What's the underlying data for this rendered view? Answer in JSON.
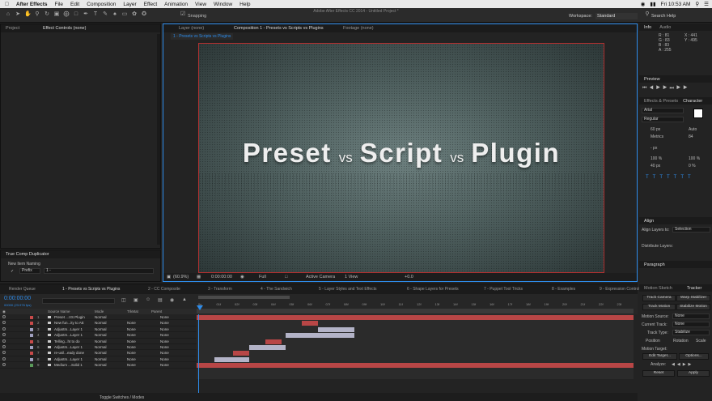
{
  "menubar": {
    "app": "After Effects",
    "items": [
      "File",
      "Edit",
      "Composition",
      "Layer",
      "Effect",
      "Animation",
      "View",
      "Window",
      "Help"
    ],
    "clock": "Fri 10:53 AM"
  },
  "toolbar": {
    "window_title": "Adobe After Effects CC 2014 - Untitled Project *",
    "snapping": "Snapping",
    "workspace_label": "Workspace:",
    "workspace_value": "Standard",
    "search_help": "Search Help"
  },
  "left_panel": {
    "tabs": [
      "Project",
      "Effect Controls (none)"
    ],
    "script_title": "True Comp Duplicator",
    "new_item_naming": "New Item Naming",
    "prefix_label": "Prefix",
    "prefix_value": "1 -"
  },
  "viewer": {
    "tabs": [
      "Layer (none)",
      "Composition 1 - Presets vs Scripts vs Plugins",
      "Footage (none)"
    ],
    "comp_chip": "1 - Presets vs Scripts vs Plugins",
    "comp_text": {
      "w1": "Preset",
      "vs1": "vs",
      "w2": "Script",
      "vs2": "vs",
      "w3": "Plugin"
    },
    "bottom": {
      "zoom": "(60.9%)",
      "timecode": "0:00:00:00",
      "resolution": "Full",
      "camera": "Active Camera",
      "views": "1 View",
      "exposure": "+0.0"
    }
  },
  "timeline": {
    "tabs": [
      "Render Queue",
      "1 - Presets vs Scripts vs Plugins",
      "2 - CC Composite",
      "3 - Transform",
      "4 - The Sandwich",
      "5 - Layer Styles and Text Effects",
      "6 - Shape Layers for Presets",
      "7 - Puppet Tool Tricks",
      "8 - Examples",
      "9 - Expression Controls"
    ],
    "timecode": "0:00:00:00",
    "frames": "00000 (23.976 fps)",
    "columns": {
      "source": "Source Name",
      "mode": "Mode",
      "trkmat": "TrkMat",
      "parent": "Parent"
    },
    "ruler_ticks": [
      "0s",
      "01f",
      "02f",
      "03f",
      "04f",
      "05f",
      "06f",
      "07f",
      "08f",
      "09f",
      "10f",
      "11f",
      "12f",
      "13f",
      "14f",
      "15f",
      "16f",
      "17f",
      "18f",
      "19f",
      "20f",
      "21f",
      "22f",
      "23f"
    ],
    "layers": [
      {
        "num": "1",
        "name": "Preset ...VS Plugin",
        "mode": "Normal",
        "trkmat": "",
        "parent": "None",
        "color": "#c84a4a"
      },
      {
        "num": "2",
        "name": "New fun...ity to AE",
        "mode": "Normal",
        "trkmat": "None",
        "parent": "None",
        "color": "#c84a4a"
      },
      {
        "num": "3",
        "name": "Adjustm...Layer 1",
        "mode": "Normal",
        "trkmat": "None",
        "parent": "None",
        "color": "#a0a0c0"
      },
      {
        "num": "4",
        "name": "Adjustm...Layer 1",
        "mode": "Normal",
        "trkmat": "None",
        "parent": "None",
        "color": "#a0a0c0"
      },
      {
        "num": "5",
        "name": "Telling...ht to do",
        "mode": "Normal",
        "trkmat": "None",
        "parent": "None",
        "color": "#c84a4a"
      },
      {
        "num": "6",
        "name": "Adjustm...Layer 1",
        "mode": "Normal",
        "trkmat": "None",
        "parent": "None",
        "color": "#a0a0c0"
      },
      {
        "num": "7",
        "name": "re-usil...eady done",
        "mode": "Normal",
        "trkmat": "None",
        "parent": "None",
        "color": "#c84a4a"
      },
      {
        "num": "8",
        "name": "Adjustm...Layer 1",
        "mode": "Normal",
        "trkmat": "None",
        "parent": "None",
        "color": "#a0a0c0"
      },
      {
        "num": "9",
        "name": "Medium ...Solid 1",
        "mode": "Normal",
        "trkmat": "None",
        "parent": "None",
        "color": "#5a9a5a"
      }
    ],
    "toggle": "Toggle Switches / Modes"
  },
  "right_panel": {
    "info": {
      "tabs": [
        "Info",
        "Audio"
      ],
      "r": "R : 81",
      "g": "G : 83",
      "b": "B : 83",
      "a": "A : 255",
      "x": "X : 441",
      "y": "Y : 495"
    },
    "preview": "Preview",
    "character": {
      "tabs": [
        "Effects & Presets",
        "Character"
      ],
      "font": "Arial",
      "style": "Regular",
      "size": "60 px",
      "leading": "Auto",
      "kerning": "Metrics",
      "tracking": "84",
      "stroke": "- px",
      "vscale": "100 %",
      "hscale": "100 %",
      "baseline": "40 px",
      "tsume": "0 %"
    },
    "align": {
      "title": "Align",
      "align_to_label": "Align Layers to:",
      "align_to_value": "Selection",
      "distribute": "Distribute Layers:"
    },
    "paragraph": "Paragraph",
    "tracker": {
      "tabs": [
        "Motion Sketch",
        "Tracker"
      ],
      "track_camera": "Track Camera",
      "warp_stabilizer": "Warp Stabilizer",
      "track_motion": "Track Motion",
      "stabilize_motion": "Stabilize Motion",
      "motion_source_label": "Motion Source:",
      "motion_source_value": "None",
      "current_track_label": "Current Track:",
      "current_track_value": "None",
      "track_type_label": "Track Type:",
      "track_type_value": "Stabilize",
      "position": "Position",
      "rotation": "Rotation",
      "scale": "Scale",
      "motion_target": "Motion Target:",
      "edit_target": "Edit Target...",
      "options": "Options...",
      "analyze": "Analyze:",
      "reset": "Reset",
      "apply": "Apply"
    }
  }
}
